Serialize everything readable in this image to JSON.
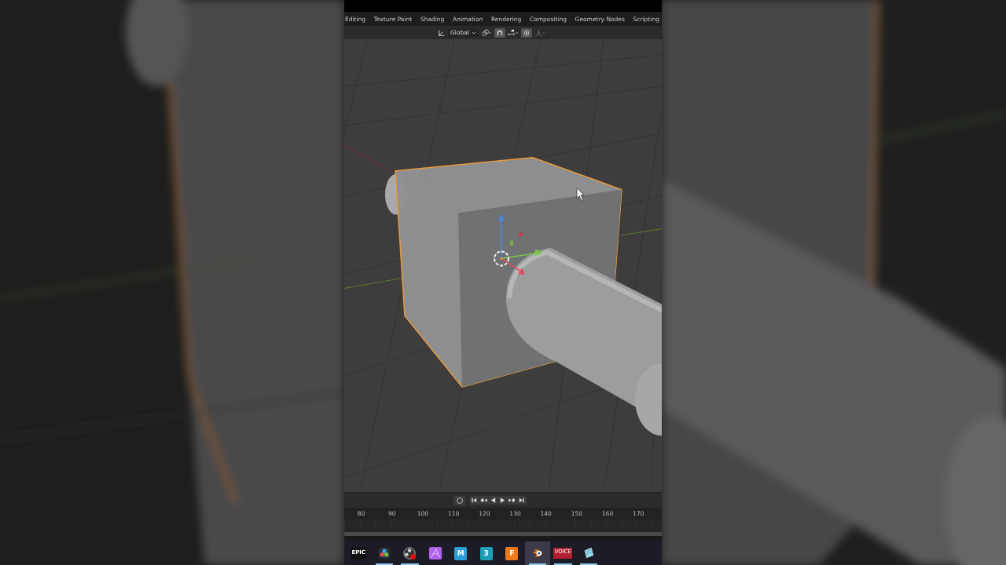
{
  "workspace_tabs": [
    {
      "label": "Editing",
      "selected": false
    },
    {
      "label": "Texture Paint",
      "selected": false
    },
    {
      "label": "Shading",
      "selected": false
    },
    {
      "label": "Animation",
      "selected": false
    },
    {
      "label": "Rendering",
      "selected": false
    },
    {
      "label": "Compositing",
      "selected": false
    },
    {
      "label": "Geometry Nodes",
      "selected": false
    },
    {
      "label": "Scripting",
      "selected": false
    }
  ],
  "header": {
    "orientation": "Global",
    "snap": {
      "on": true
    },
    "proportional_editing": {
      "on": true
    }
  },
  "timeline": {
    "frames": [
      "80",
      "90",
      "100",
      "110",
      "120",
      "130",
      "140",
      "150",
      "160",
      "170"
    ]
  },
  "taskbar": [
    {
      "kind": "epic",
      "label": "EPIC",
      "running": false,
      "selected": false
    },
    {
      "kind": "resolve",
      "running": true,
      "selected": false
    },
    {
      "kind": "obs",
      "running": true,
      "selected": false
    },
    {
      "kind": "affinity",
      "running": false,
      "selected": false
    },
    {
      "kind": "tile",
      "label": "M",
      "color": "#2a9fd6",
      "running": false,
      "selected": false
    },
    {
      "kind": "tile",
      "label": "3",
      "color": "#1e9fb5",
      "running": false,
      "selected": false
    },
    {
      "kind": "tile",
      "label": "F",
      "color": "#f07a1a",
      "running": false,
      "selected": false
    },
    {
      "kind": "blender",
      "running": true,
      "selected": true
    },
    {
      "kind": "voicemeeter",
      "label": "VOICE",
      "running": true,
      "selected": false
    },
    {
      "kind": "notepad",
      "running": true,
      "selected": false
    }
  ]
}
